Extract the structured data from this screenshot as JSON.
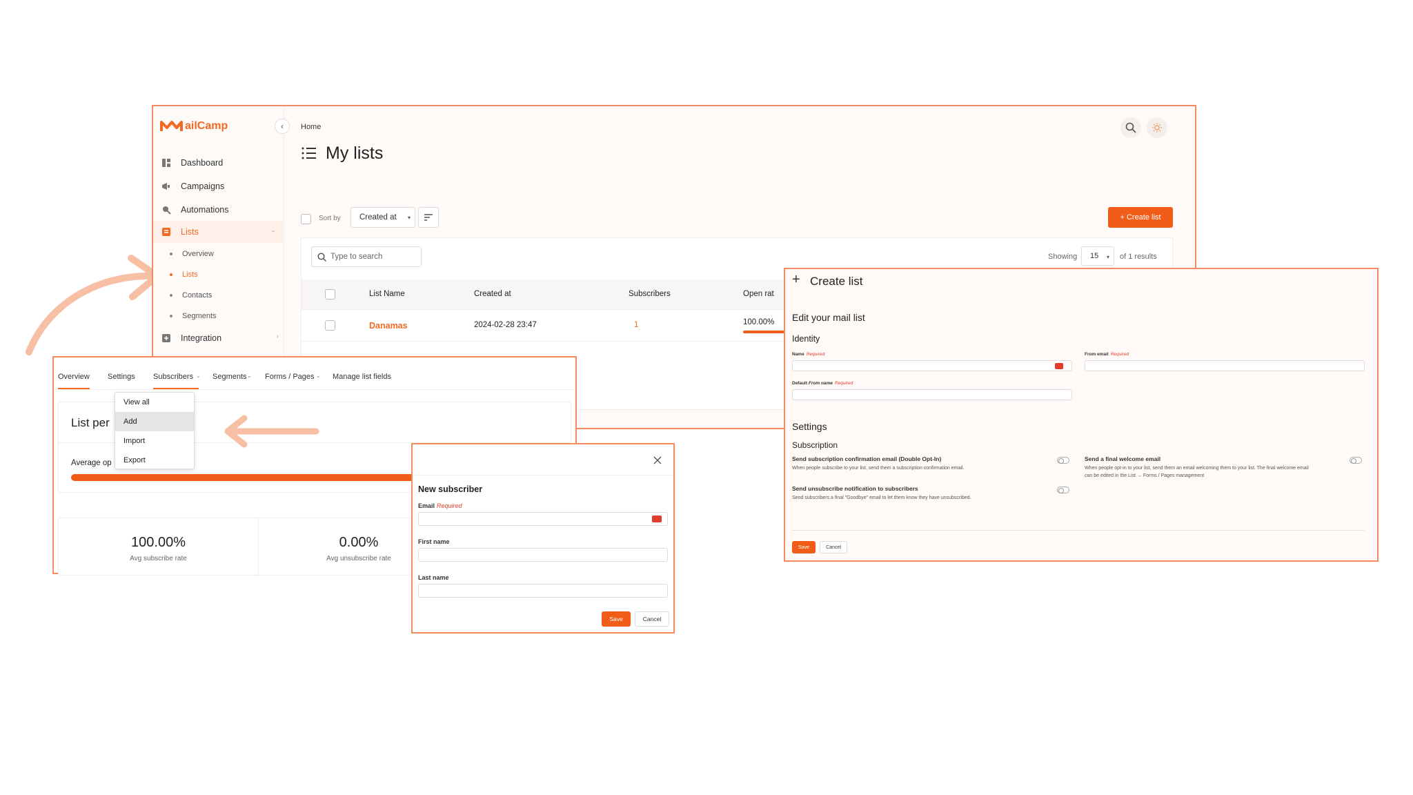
{
  "brand": {
    "name": "MailCamp",
    "logo_text": "ailCamp",
    "accent": "#f26a21"
  },
  "sidebar": {
    "items": [
      {
        "label": "Dashboard",
        "icon": "dashboard-icon"
      },
      {
        "label": "Campaigns",
        "icon": "megaphone-icon"
      },
      {
        "label": "Automations",
        "icon": "automation-icon"
      },
      {
        "label": "Lists",
        "icon": "list-icon"
      },
      {
        "label": "Integration",
        "icon": "integration-icon"
      }
    ],
    "sub_items": [
      "Overview",
      "Lists",
      "Contacts",
      "Segments"
    ]
  },
  "header": {
    "breadcrumb": "Home",
    "title": "My lists"
  },
  "toolbar": {
    "sort_label": "Sort by",
    "sort_value": "Created at",
    "create_button": "+ Create list"
  },
  "search": {
    "placeholder": "Type to search"
  },
  "pagination": {
    "showing_label": "Showing",
    "page_size": "15",
    "results_label": "of 1 results"
  },
  "table": {
    "headers": [
      "List Name",
      "Created at",
      "Subscribers",
      "Open rat"
    ],
    "rows": [
      {
        "name": "Danamas",
        "created": "2024-02-28 23:47",
        "subscribers": "1",
        "open_rate": "100.00%"
      }
    ]
  },
  "detail": {
    "tabs": [
      "Overview",
      "Settings",
      "Subscribers",
      "Segments",
      "Forms / Pages",
      "Manage list fields"
    ],
    "dropdown": [
      "View all",
      "Add",
      "Import",
      "Export"
    ],
    "perf_title": "List per",
    "avg_label": "Average op",
    "stats": [
      {
        "value": "100.00%",
        "label": "Avg subscribe rate"
      },
      {
        "value": "0.00%",
        "label": "Avg unsubscribe rate"
      }
    ]
  },
  "modal": {
    "title": "New subscriber",
    "email_label": "Email",
    "required": "Required",
    "first_name_label": "First name",
    "last_name_label": "Last name",
    "save": "Save",
    "cancel": "Cancel"
  },
  "create": {
    "title": "Create list",
    "subtitle": "Edit your mail list",
    "identity": "Identity",
    "name_label": "Name",
    "from_email_label": "From email",
    "default_from_prefix": "Default",
    "default_from_name": "From name",
    "required": "Required",
    "settings": "Settings",
    "subscription": "Subscription",
    "opt1_title": "Send subscription confirmation email (Double Opt-In)",
    "opt1_desc": "When people subscribe to your list, send them a subscription confirmation email.",
    "opt2_title": "Send unsubscribe notification to subscribers",
    "opt2_desc": "Send subscribers a final \"Goodbye\" email to let them know they have unsubscribed.",
    "opt3_title": "Send a final welcome email",
    "opt3_desc1": "When people opt-in to your list, send them an email welcoming them to your list. The final welcome email",
    "opt3_desc2": "can be edited in the List → Forms / Pages management",
    "save": "Save",
    "cancel": "Cancel"
  }
}
